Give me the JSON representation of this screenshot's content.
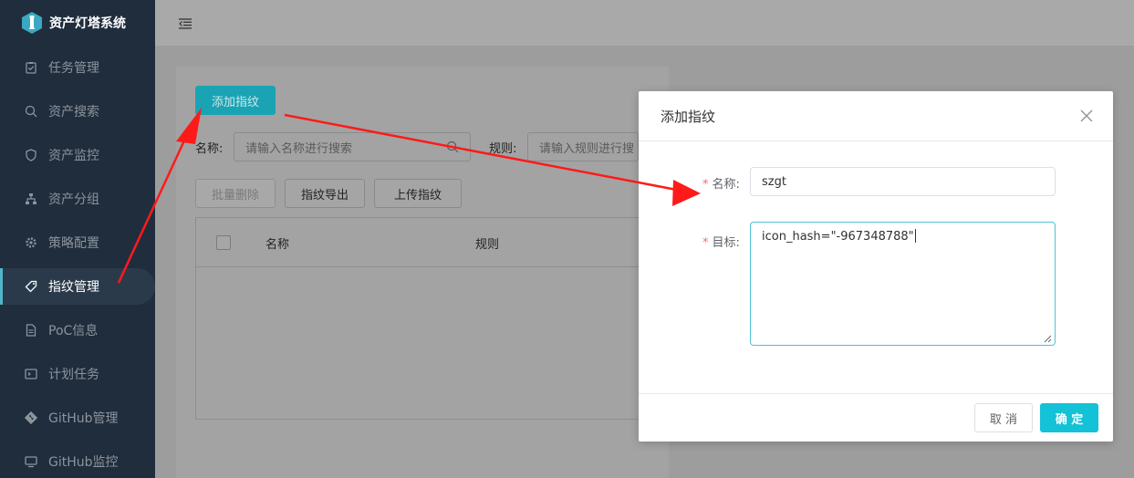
{
  "app": {
    "title": "资产灯塔系统"
  },
  "sidebar": {
    "items": [
      {
        "label": "任务管理",
        "icon": "task-icon"
      },
      {
        "label": "资产搜索",
        "icon": "search-icon"
      },
      {
        "label": "资产监控",
        "icon": "shield-icon"
      },
      {
        "label": "资产分组",
        "icon": "sitemap-icon"
      },
      {
        "label": "策略配置",
        "icon": "gear-icon"
      },
      {
        "label": "指纹管理",
        "icon": "tag-icon",
        "active": true
      },
      {
        "label": "PoC信息",
        "icon": "document-icon"
      },
      {
        "label": "计划任务",
        "icon": "terminal-icon"
      },
      {
        "label": "GitHub管理",
        "icon": "git-icon"
      },
      {
        "label": "GitHub监控",
        "icon": "monitor-icon"
      }
    ]
  },
  "page": {
    "add_button": "添加指纹",
    "name_label": "名称:",
    "name_placeholder": "请输入名称进行搜索",
    "rule_label": "规则:",
    "rule_placeholder": "请输入规则进行搜",
    "batch_delete": "批量删除",
    "export": "指纹导出",
    "upload": "上传指纹",
    "table": {
      "columns": [
        "名称",
        "规则"
      ]
    }
  },
  "modal": {
    "title": "添加指纹",
    "name_label": "名称:",
    "name_value": "szgt",
    "target_label": "目标:",
    "target_value": "icon_hash=\"-967348788\"",
    "cancel": "取 消",
    "confirm": "确 定"
  },
  "colors": {
    "accent": "#13c2d6",
    "sidebar_bg": "#1f2d3d",
    "arrow": "#ff1a1a",
    "required": "#f56c6c"
  }
}
